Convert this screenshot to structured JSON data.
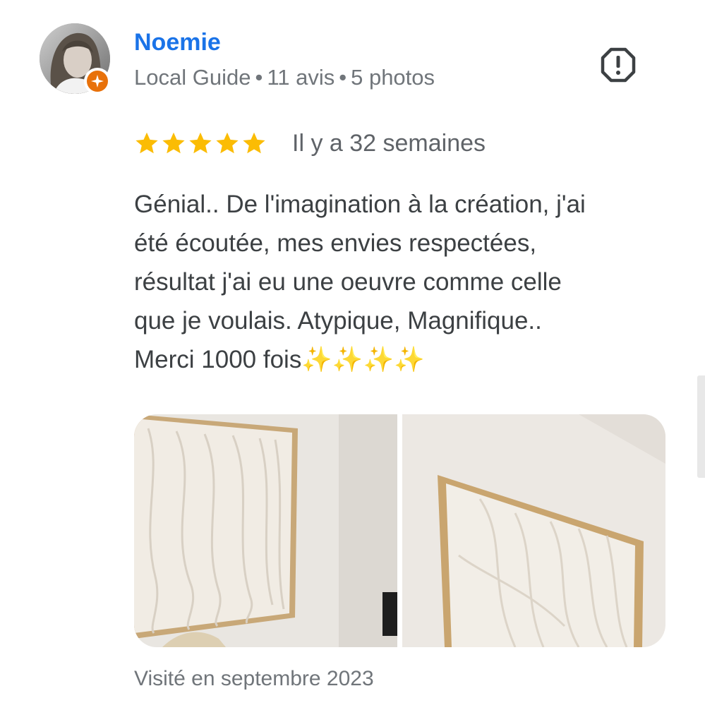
{
  "reviewer": {
    "name": "Noemie",
    "badge": "Local Guide",
    "separator": "•",
    "reviews_count": "11 avis",
    "photos_count": "5 photos",
    "avatar_icon": "user-avatar",
    "badge_icon": "local-guide-star-icon"
  },
  "actions": {
    "report_icon": "report-octagon-icon"
  },
  "review": {
    "rating": 5,
    "max_rating": 5,
    "date": "Il y a 32 semaines",
    "lines": [
      "Génial.. De l'imagination à la création, j'ai",
      "été écoutée, mes envies respectées,",
      "résultat j'ai eu une oeuvre comme celle",
      "que je voulais. Atypique, Magnifique..",
      "Merci 1000 fois✨✨✨✨"
    ],
    "visited": "Visité en septembre 2023"
  },
  "colors": {
    "name": "#1a73e8",
    "star": "#fbbc04",
    "meta": "#70757a",
    "text": "#3c4043",
    "badge": "#e8710a"
  }
}
